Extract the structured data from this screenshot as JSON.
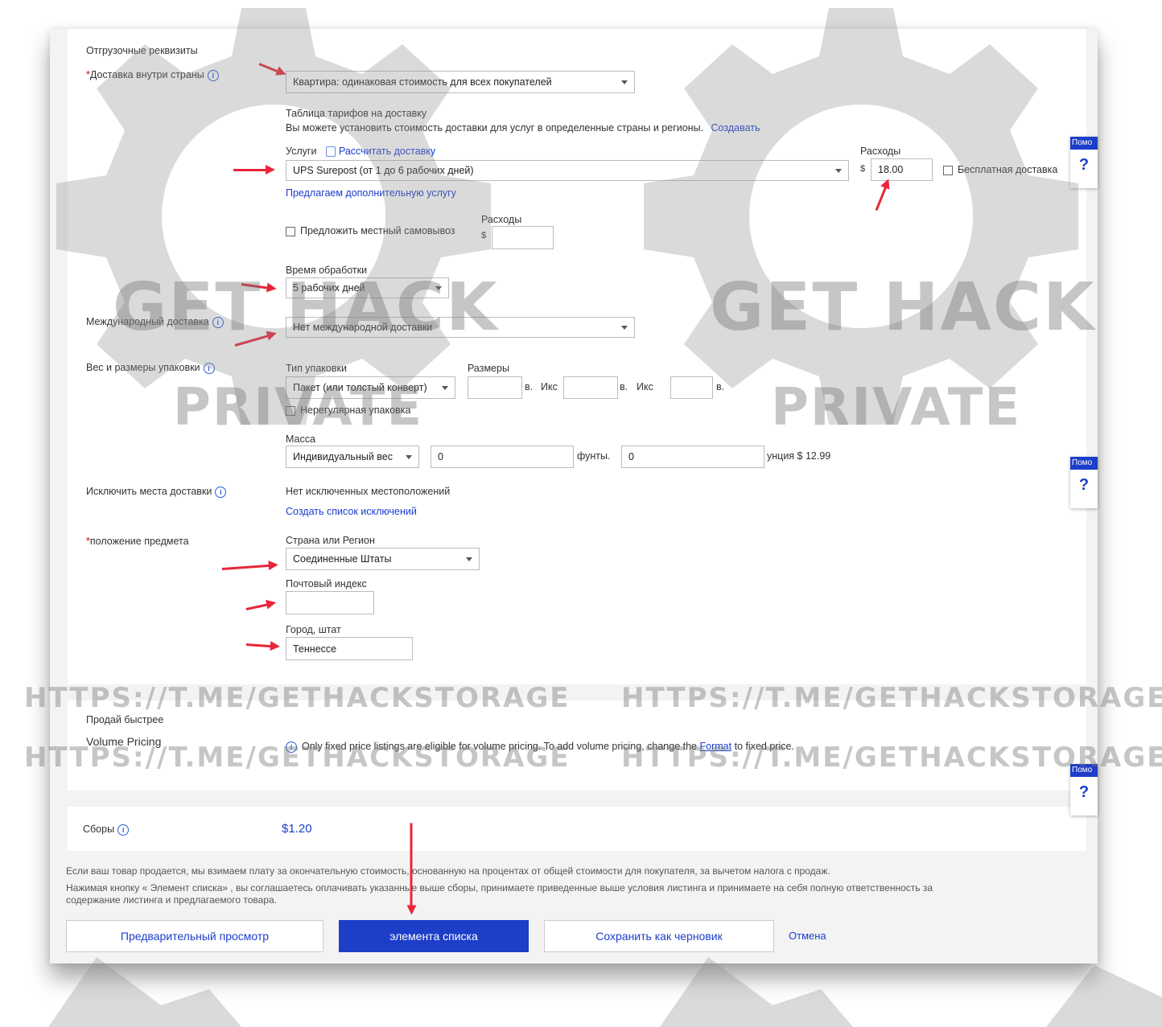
{
  "shipping": {
    "section_title": "Отгрузочные реквизиты",
    "domestic_label": "Доставка внутри страны",
    "domestic_required": "*",
    "domestic_value": "Квартира: одинаковая стоимость для всех покупателей",
    "rate_table_title": "Таблица тарифов на доставку",
    "rate_table_text": "Вы можете установить стоимость доставки для услуг в определенные страны и регионы.",
    "rate_table_link": "Создавать",
    "services_label": "Услуги",
    "calc_link": "Рассчитать доставку",
    "service_value": "UPS Surepost (от 1 до 6 рабочих дней)",
    "cost_label": "Расходы",
    "currency": "$",
    "cost_value": "18.00",
    "free_shipping_label": "Бесплатная доставка",
    "add_service_link": "Предлагаем дополнительную услугу",
    "pickup_label": "Предложить местный самовывоз",
    "pickup_cost_label": "Расходы",
    "pickup_currency": "$",
    "pickup_cost_value": "",
    "handling_label": "Время обработки",
    "handling_value": "5 рабочих дней",
    "intl_label": "Международный доставка",
    "intl_value": "Нет международной доставки",
    "package_label": "Вес и размеры упаковки",
    "package_type_label": "Тип упаковки",
    "package_type_value": "Пакет (или толстый конверт)",
    "dimensions_label": "Размеры",
    "dim_unit": "в.",
    "dim_x": "Икс",
    "irregular_label": "Нерегулярная упаковка",
    "weight_label": "Масса",
    "weight_type_value": "Индивидуальный вес",
    "weight_lb_value": "0",
    "weight_lb_unit": "фунты.",
    "weight_oz_value": "0",
    "weight_oz_unit": "унция $ 12.99",
    "exclude_label": "Исключить места доставки",
    "exclude_status": "Нет исключенных местоположений",
    "exclude_link": "Создать список исключений",
    "location_label": "положение предмета",
    "location_required": "*",
    "country_label": "Страна или Регион",
    "country_value": "Соединенные Штаты",
    "zip_label": "Почтовый индекс",
    "zip_value": "",
    "city_label": "Город, штат",
    "city_value": "Теннессе"
  },
  "sell_faster": {
    "title": "Продай быстрее",
    "volume_label": "Volume Pricing",
    "volume_note_1": "Only fixed price listings are eligible for volume pricing. To add volume pricing, change the",
    "volume_note_link": "Format",
    "volume_note_2": "to fixed price."
  },
  "fees": {
    "label": "Сборы",
    "value": "$1.20"
  },
  "legal": {
    "line1": "Если ваш товар продается, мы взимаем плату за окончательную стоимость, основанную на процентах от общей стоимости для покупателя, за вычетом налога с продаж.",
    "line2": "Нажимая кнопку « Элемент списка» , вы соглашаетесь оплачивать указанные выше сборы, принимаете приведенные выше условия листинга и принимаете на себя полную ответственность за",
    "line3": "содержание листинга и предлагаемого товара."
  },
  "actions": {
    "preview": "Предварительный просмотр",
    "list": "элемента списка",
    "save_draft": "Сохранить как черновик",
    "cancel": "Отмена"
  },
  "help_tab": {
    "label": "Помо",
    "q": "?"
  },
  "watermark": {
    "brand_1": "GET HACK",
    "brand_2": "PRIVATE",
    "url": "HTTPS://T.ME/GETHACKSTORAGE"
  },
  "colors": {
    "primary_button": "#1d3ec9",
    "link": "#1a3ccf",
    "arrow": "#e8253a",
    "watermark": "#8c8c8c"
  }
}
